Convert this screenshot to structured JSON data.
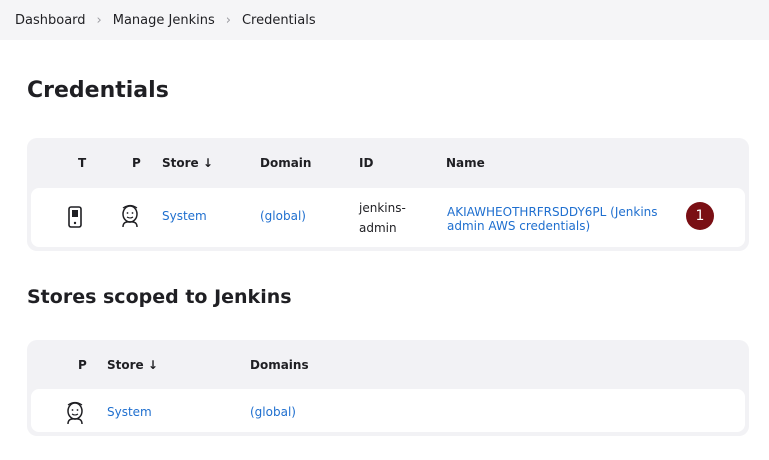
{
  "breadcrumb": {
    "items": [
      "Dashboard",
      "Manage Jenkins",
      "Credentials"
    ],
    "separator": "›"
  },
  "page_title": "Credentials",
  "credentials_table": {
    "headers": {
      "t": "T",
      "p": "P",
      "store": "Store ↓",
      "domain": "Domain",
      "id": "ID",
      "name": "Name"
    },
    "rows": [
      {
        "type_icon": "mobile-phone-icon",
        "provider_icon": "jenkins-butler-icon",
        "store": "System",
        "domain": "(global)",
        "id_line1": "jenkins-",
        "id_line2": "admin",
        "name": "AKIAWHEOTHRFRSDDY6PL (Jenkins admin AWS credentials)"
      }
    ]
  },
  "stores_section_title": "Stores scoped to Jenkins",
  "stores_table": {
    "headers": {
      "p": "P",
      "store": "Store ↓",
      "domains": "Domains"
    },
    "rows": [
      {
        "provider_icon": "jenkins-butler-icon",
        "store": "System",
        "domains": "(global)"
      }
    ]
  },
  "annotation_badge": "1",
  "colors": {
    "link": "#1f6fcf",
    "badge": "#7a0f14",
    "table_bg": "#f2f2f5"
  }
}
